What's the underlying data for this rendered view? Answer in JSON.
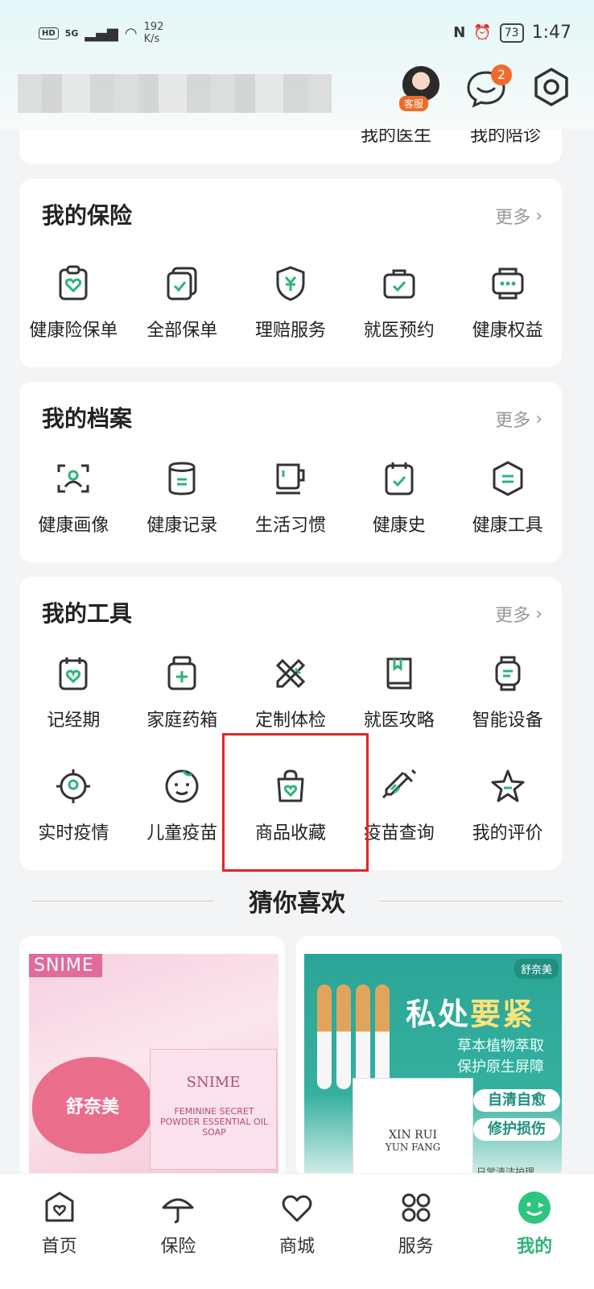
{
  "status_bar": {
    "hd": "HD",
    "net": "5G",
    "speed_value": "192",
    "speed_unit": "K/s",
    "battery": "73",
    "time": "1:47"
  },
  "header": {
    "kefu_label": "客服",
    "message_badge": "2"
  },
  "peek_row": {
    "left": "我的医生",
    "right": "我的陪诊"
  },
  "insurance": {
    "title": "我的保险",
    "more": "更多",
    "items": [
      {
        "label": "健康险保单",
        "icon": "clipboard-heart-icon"
      },
      {
        "label": "全部保单",
        "icon": "stacked-check-icon"
      },
      {
        "label": "理赔服务",
        "icon": "shield-yen-icon"
      },
      {
        "label": "就医预约",
        "icon": "bag-check-icon"
      },
      {
        "label": "健康权益",
        "icon": "ticket-dots-icon"
      }
    ]
  },
  "records": {
    "title": "我的档案",
    "more": "更多",
    "items": [
      {
        "label": "健康画像",
        "icon": "scan-person-icon"
      },
      {
        "label": "健康记录",
        "icon": "cylinder-record-icon"
      },
      {
        "label": "生活习惯",
        "icon": "mug-icon"
      },
      {
        "label": "健康史",
        "icon": "calendar-check-icon"
      },
      {
        "label": "健康工具",
        "icon": "hexagon-tool-icon"
      }
    ]
  },
  "tools": {
    "title": "我的工具",
    "more": "更多",
    "row1": [
      {
        "label": "记经期",
        "icon": "calendar-heart-icon"
      },
      {
        "label": "家庭药箱",
        "icon": "medicine-box-icon"
      },
      {
        "label": "定制体检",
        "icon": "ruler-pencil-icon"
      },
      {
        "label": "就医攻略",
        "icon": "book-icon"
      },
      {
        "label": "智能设备",
        "icon": "smartwatch-icon"
      }
    ],
    "row2": [
      {
        "label": "实时疫情",
        "icon": "virus-icon"
      },
      {
        "label": "儿童疫苗",
        "icon": "baby-face-icon"
      },
      {
        "label": "商品收藏",
        "icon": "shopping-bag-heart-icon"
      },
      {
        "label": "疫苗查询",
        "icon": "syringe-icon"
      },
      {
        "label": "我的评价",
        "icon": "star-icon"
      }
    ]
  },
  "recommend": {
    "title": "猜你喜欢",
    "product1": {
      "tag": "SNIME",
      "heart_text": "舒奈美",
      "box_brand": "SNIME",
      "box_sub": "FEMININE SECRET POWDER ESSENTIAL OIL SOAP"
    },
    "product2": {
      "brand": "舒奈美",
      "headline_a": "私处",
      "headline_b": "要紧",
      "sub1": "草本植物萃取",
      "sub2": "保护原生屏障",
      "pill1": "自清自愈",
      "pill2": "修护损伤",
      "box_l1": "XIN RUI",
      "box_l2": "YUN FANG",
      "daily": "日常清洁护理"
    }
  },
  "bottom_nav": [
    {
      "label": "首页",
      "icon": "home-heart-icon"
    },
    {
      "label": "保险",
      "icon": "umbrella-icon"
    },
    {
      "label": "商城",
      "icon": "heart-outline-icon"
    },
    {
      "label": "服务",
      "icon": "four-circles-icon"
    },
    {
      "label": "我的",
      "icon": "smiley-face-icon",
      "active": true
    }
  ],
  "colors": {
    "accent": "#2cb47a",
    "badge": "#f26a2a",
    "highlight": "#e2242a"
  }
}
